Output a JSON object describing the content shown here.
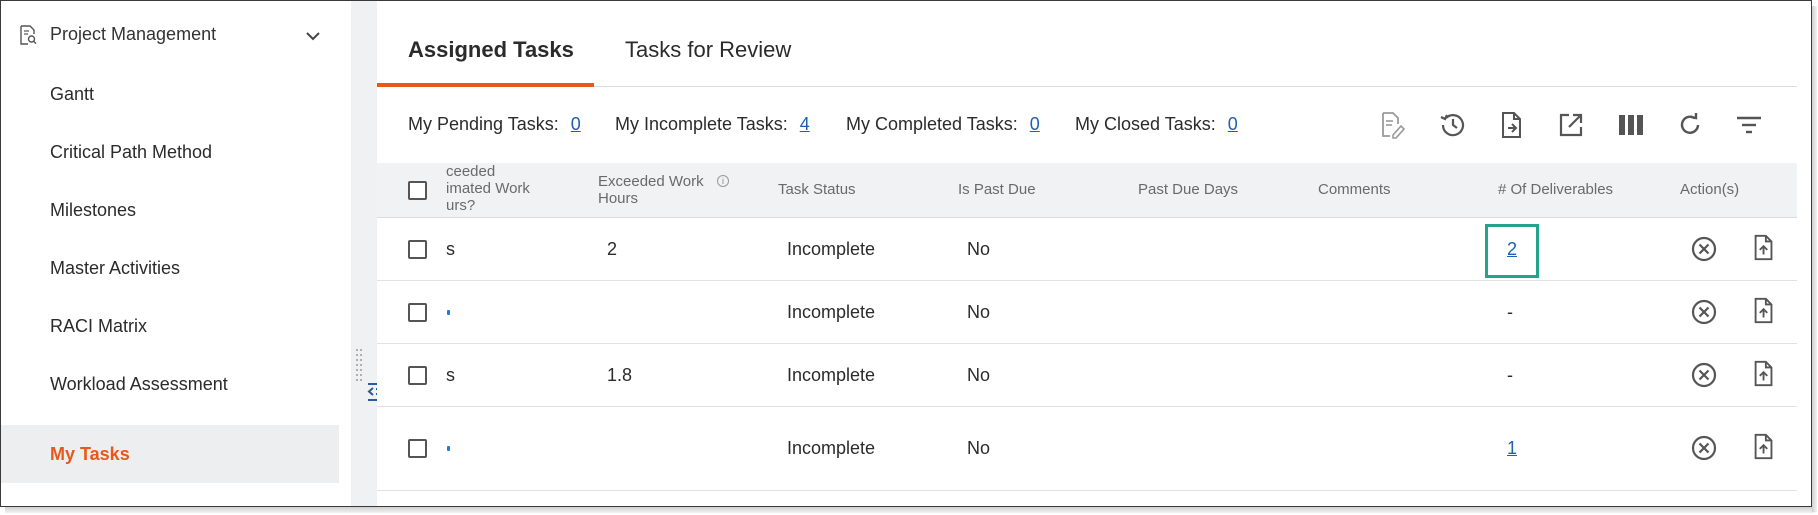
{
  "sidebar": {
    "header": "Project Management",
    "items": [
      {
        "label": "Gantt"
      },
      {
        "label": "Critical Path Method"
      },
      {
        "label": "Milestones"
      },
      {
        "label": "Master Activities"
      },
      {
        "label": "RACI Matrix"
      },
      {
        "label": "Workload Assessment"
      },
      {
        "label": "My Tasks",
        "active": true
      }
    ]
  },
  "tabs": [
    {
      "label": "Assigned Tasks",
      "active": true
    },
    {
      "label": "Tasks for Review"
    }
  ],
  "summary": {
    "pending_label": "My Pending Tasks:",
    "pending_value": "0",
    "incomplete_label": "My Incomplete Tasks:",
    "incomplete_value": "4",
    "completed_label": "My Completed Tasks:",
    "completed_value": "0",
    "closed_label": "My Closed Tasks:",
    "closed_value": "0"
  },
  "toolbar": {
    "icons": [
      "edit-document-icon",
      "history-icon",
      "export-document-icon",
      "open-external-icon",
      "columns-icon",
      "refresh-icon",
      "filter-icon"
    ]
  },
  "table": {
    "columns": {
      "exceeded_est_line1": "ceeded",
      "exceeded_est_line2": "imated Work",
      "exceeded_est_line3": "urs?",
      "exceeded_work_line1": "Exceeded Work",
      "exceeded_work_line2": "Hours",
      "task_status": "Task Status",
      "is_past_due": "Is Past Due",
      "past_due_days": "Past Due Days",
      "comments": "Comments",
      "deliverables": "# Of Deliverables",
      "actions": "Action(s)"
    },
    "rows": [
      {
        "exceeded_est": "s",
        "exceeded_work": "2",
        "task_status": "Incomplete",
        "is_past_due": "No",
        "past_due_days": "",
        "comments": "",
        "deliverables": "2",
        "deliverables_link": true
      },
      {
        "exceeded_est": "",
        "exceeded_work": "",
        "task_status": "Incomplete",
        "is_past_due": "No",
        "past_due_days": "",
        "comments": "",
        "deliverables": "-",
        "deliverables_link": false
      },
      {
        "exceeded_est": "s",
        "exceeded_work": "1.8",
        "task_status": "Incomplete",
        "is_past_due": "No",
        "past_due_days": "",
        "comments": "",
        "deliverables": "-",
        "deliverables_link": false
      },
      {
        "exceeded_est": "",
        "exceeded_work": "",
        "task_status": "Incomplete",
        "is_past_due": "No",
        "past_due_days": "",
        "comments": "",
        "deliverables": "1",
        "deliverables_link": true
      }
    ]
  },
  "colors": {
    "accent": "#e8581c",
    "link": "#1f5fb4",
    "highlight": "#22a38a"
  }
}
